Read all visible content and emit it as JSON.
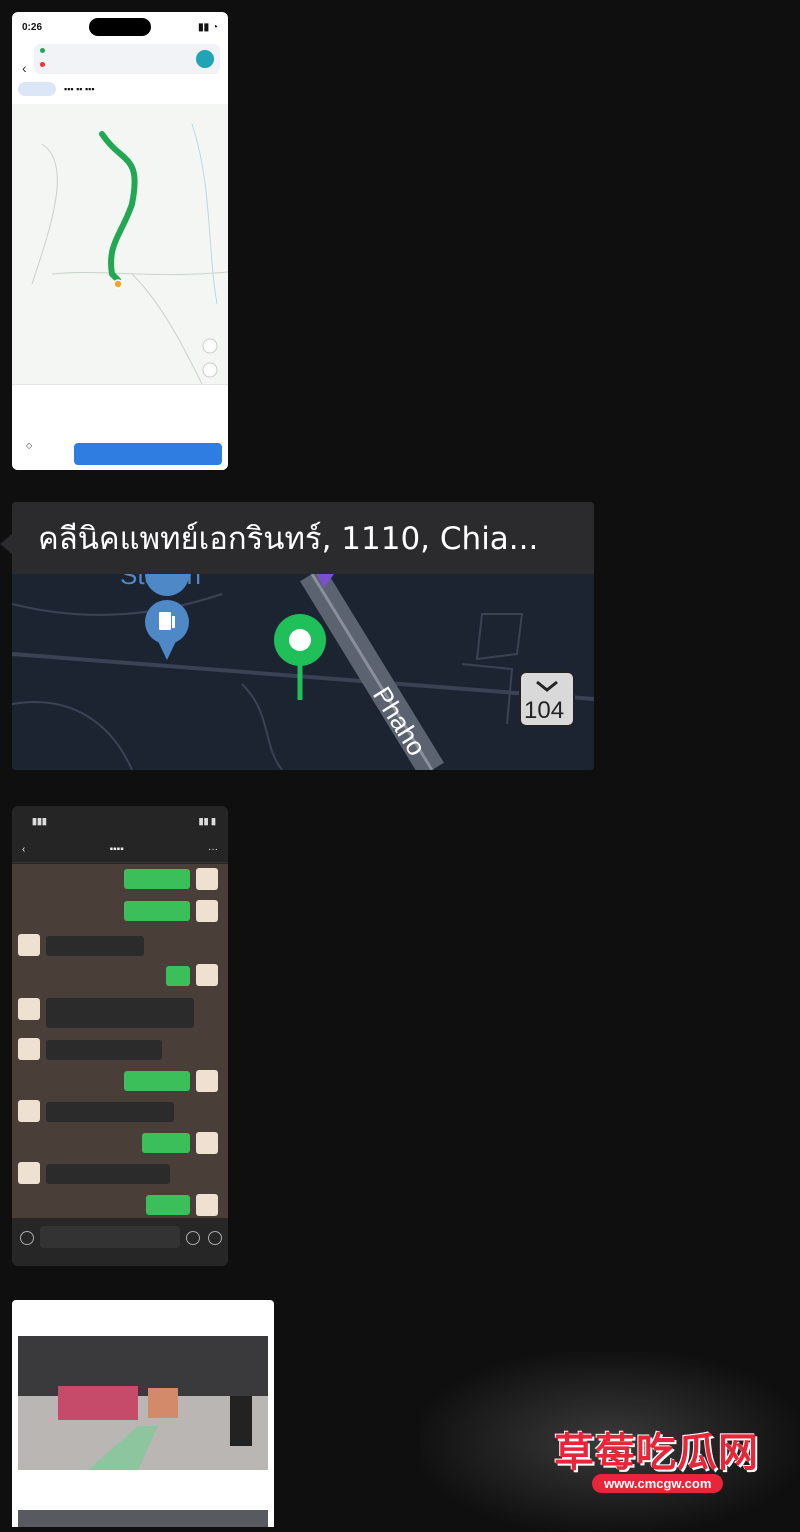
{
  "thumb_map": {
    "status_time": "0:26",
    "route_from": "",
    "route_to": "",
    "distance_text": "",
    "go_label": "",
    "colors": {
      "route": "#22a852",
      "accent": "#2f7de1"
    }
  },
  "thumb_location": {
    "title": "คลีนิคแพทย์เอกรินทร์, 1110, Chia...",
    "map_labels": {
      "station": "Station",
      "road_sign": "104",
      "road_name": "Phaho"
    },
    "colors": {
      "pin": "#1fbf5a",
      "map_bg": "#1d2431"
    }
  },
  "thumb_chat": {
    "messages": [
      {
        "side": "mine"
      },
      {
        "side": "mine"
      },
      {
        "side": "theirs"
      },
      {
        "side": "mine"
      },
      {
        "side": "theirs"
      },
      {
        "side": "theirs"
      },
      {
        "side": "mine"
      },
      {
        "side": "theirs"
      },
      {
        "side": "mine"
      },
      {
        "side": "theirs"
      },
      {
        "side": "mine"
      }
    ],
    "colors": {
      "mine_bubble": "#3bbf5b"
    }
  },
  "thumb_article": {},
  "watermark": {
    "brand": "草莓吃瓜网",
    "url": "www.cmcgw.com"
  }
}
